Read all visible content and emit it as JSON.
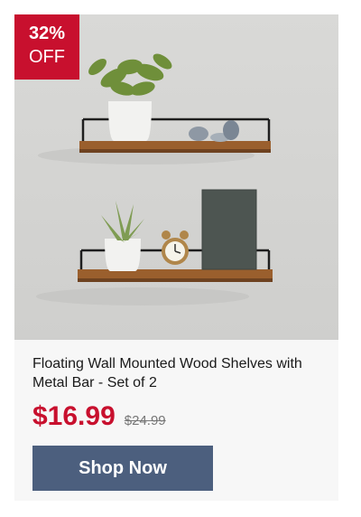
{
  "badge": {
    "percent": "32%",
    "label": "OFF"
  },
  "product": {
    "title": "Floating Wall Mounted Wood Shelves with Metal Bar - Set of 2",
    "price": "$16.99",
    "original_price": "$24.99"
  },
  "cta": {
    "label": "Shop Now"
  },
  "colors": {
    "accent": "#c8102e",
    "button": "#4c5f7e"
  }
}
